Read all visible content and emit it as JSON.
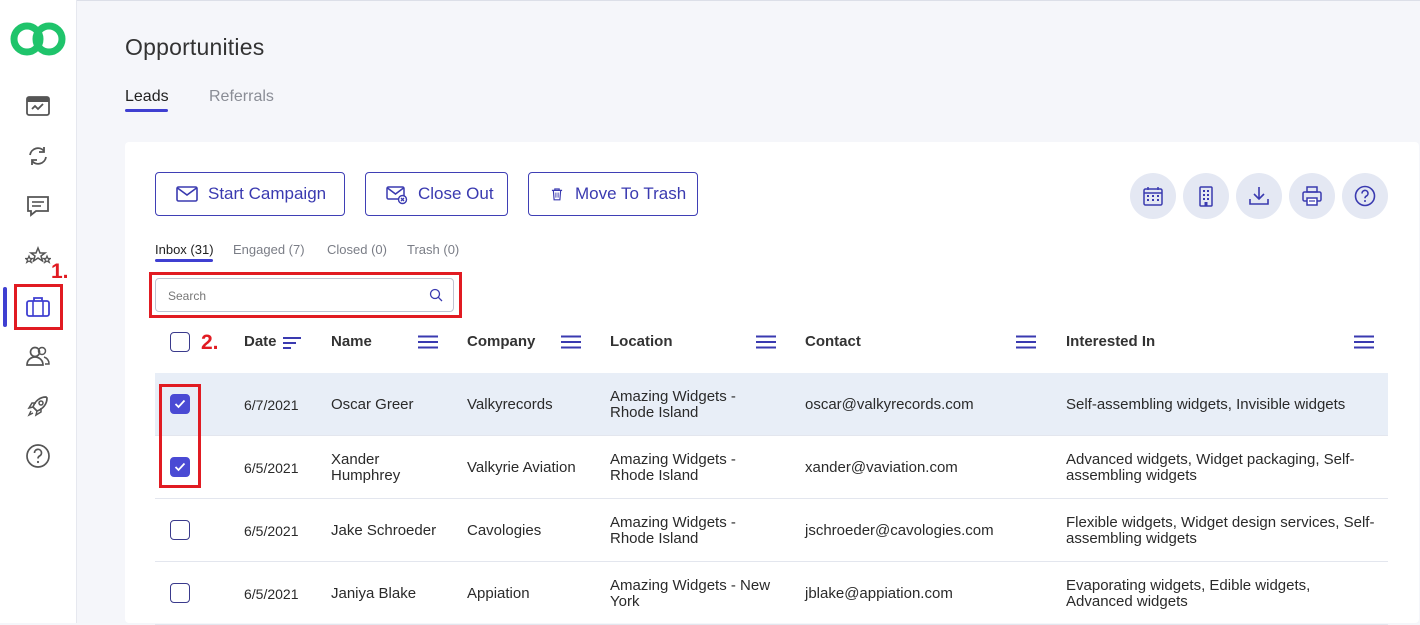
{
  "page": {
    "title": "Opportunities",
    "tabs": [
      {
        "label": "Leads",
        "active": true
      },
      {
        "label": "Referrals",
        "active": false
      }
    ]
  },
  "sidebar": {
    "icons": [
      "calendar-dashboard-icon",
      "sync-icon",
      "chat-icon",
      "stars-icon",
      "briefcase-icon",
      "users-icon",
      "rocket-icon",
      "help-icon"
    ],
    "active": "briefcase-icon"
  },
  "annotations": {
    "one": "1.",
    "two": "2."
  },
  "toolbar": {
    "start_campaign": "Start Campaign",
    "close_out": "Close Out",
    "move_to_trash": "Move To Trash"
  },
  "subtabs": [
    {
      "label": "Inbox (31)",
      "active": true
    },
    {
      "label": "Engaged (7)",
      "active": false
    },
    {
      "label": "Closed (0)",
      "active": false
    },
    {
      "label": "Trash (0)",
      "active": false
    }
  ],
  "search": {
    "placeholder": "Search",
    "value": ""
  },
  "table": {
    "columns": [
      "Date",
      "Name",
      "Company",
      "Location",
      "Contact",
      "Interested In"
    ],
    "rows": [
      {
        "checked": true,
        "date": "6/7/2021",
        "name1": "Oscar Greer",
        "name2": "",
        "company": "Valkyrecords",
        "loc1": "Amazing Widgets -",
        "loc2": "Rhode Island",
        "contact": "oscar@valkyrecords.com",
        "int1": "Self-assembling widgets, Invisible widgets",
        "int2": ""
      },
      {
        "checked": true,
        "date": "6/5/2021",
        "name1": "Xander",
        "name2": "Humphrey",
        "company": "Valkyrie Aviation",
        "loc1": "Amazing Widgets -",
        "loc2": "Rhode Island",
        "contact": "xander@vaviation.com",
        "int1": "Advanced widgets, Widget packaging, Self-",
        "int2": "assembling widgets"
      },
      {
        "checked": false,
        "date": "6/5/2021",
        "name1": "Jake Schroeder",
        "name2": "",
        "company": "Cavologies",
        "loc1": "Amazing Widgets -",
        "loc2": "Rhode Island",
        "contact": "jschroeder@cavologies.com",
        "int1": "Flexible widgets, Widget design services, Self-",
        "int2": "assembling widgets"
      },
      {
        "checked": false,
        "date": "6/5/2021",
        "name1": "Janiya Blake",
        "name2": "",
        "company": "Appiation",
        "loc1": "Amazing Widgets - New",
        "loc2": "York",
        "contact": "jblake@appiation.com",
        "int1": "Evaporating widgets, Edible widgets,",
        "int2": "Advanced widgets"
      }
    ]
  },
  "colors": {
    "accent": "#3f3fd1",
    "annotation": "#e11b22",
    "logo": "#1fc46b",
    "selected_row": "#e8eef7"
  }
}
